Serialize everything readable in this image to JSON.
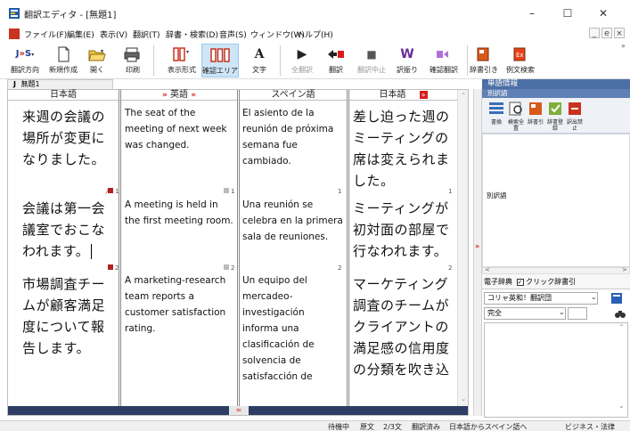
{
  "window": {
    "title": "翻訳エディタ - [無題1]",
    "min_icon": "minimize-icon",
    "max_icon": "maximize-icon",
    "close_icon": "close-icon"
  },
  "menu": {
    "items": [
      "ファイル(F)",
      "編集(E)",
      "表示(V)",
      "翻訳(T)",
      "辞書・検索(D)",
      "音声(S)",
      "ウィンドウ(W)",
      "ヘルプ(H)"
    ],
    "mdi": [
      "_",
      "ｅ",
      "×"
    ]
  },
  "toolbar": {
    "items": [
      {
        "label": "翻訳方向",
        "glyph": "J»S",
        "icon": "translation-direction-icon",
        "enabled": true
      },
      {
        "label": "新規作成",
        "glyph": "",
        "icon": "new-document-icon",
        "enabled": true
      },
      {
        "label": "開く",
        "glyph": "",
        "icon": "open-folder-icon",
        "enabled": true
      },
      {
        "label": "印刷",
        "glyph": "",
        "icon": "printer-icon",
        "enabled": true
      },
      {
        "label": "表示形式",
        "glyph": "",
        "icon": "display-format-icon",
        "enabled": true
      },
      {
        "label": "確認エリア",
        "glyph": "",
        "icon": "confirmation-area-icon",
        "enabled": true,
        "active": true
      },
      {
        "label": "文字",
        "glyph": "A",
        "icon": "font-icon",
        "enabled": true
      },
      {
        "label": "全翻訳",
        "glyph": "▶",
        "icon": "translate-all-icon",
        "enabled": false
      },
      {
        "label": "翻訳",
        "glyph": "",
        "icon": "translate-icon",
        "enabled": true
      },
      {
        "label": "翻訳中止",
        "glyph": "■",
        "icon": "stop-translation-icon",
        "enabled": false
      },
      {
        "label": "訳振り",
        "glyph": "W",
        "icon": "interlinear-icon",
        "enabled": true
      },
      {
        "label": "確認翻訳",
        "glyph": "",
        "icon": "check-translation-icon",
        "enabled": true
      }
    ],
    "right_items": [
      {
        "label": "辞書引き",
        "icon": "dictionary-lookup-icon"
      },
      {
        "label": "例文検索",
        "icon": "example-search-icon"
      }
    ],
    "overflow": "»"
  },
  "document": {
    "tab_label": "無題1",
    "tab_prefix": "J"
  },
  "columns": {
    "headers": [
      "日本語",
      "英語",
      "スペイン語",
      "日本語"
    ],
    "arrow_left": "»",
    "arrow_right": "«",
    "arrow_box": "»"
  },
  "rows": [
    {
      "num": "",
      "ja": "来週の会議の場所が変更になりました。",
      "en": "The seat of the meeting of next week was changed.",
      "es": "El asiento de la reunión de próxima semana fue cambiado.",
      "ja_back": "差し迫った週のミーティングの席は変えられました。"
    },
    {
      "num": "1",
      "ja": "会議は第一会議室でおこなわれます。",
      "en": "A meeting is held in the first meeting room.",
      "es": "Una reunión se celebra en la primera sala de reuniones.",
      "ja_back": "ミーティングが初対面の部屋で行なわれます。"
    },
    {
      "num": "2",
      "ja": "市場調査チームが顧客満足度について報告します。",
      "en": "A marketing-research team reports a customer satisfaction rating.",
      "es": "Un equipo del mercadeo-investigación informa una clasificación de solvencia de satisfacción de cliente.",
      "ja_back": "マーケティング調査のチームがクライアントの満足感の信用度の分類を吹き込"
    }
  ],
  "editor": {
    "scroll_center": "≈"
  },
  "status": {
    "items": [
      "待機中",
      "原文",
      "2/3文",
      "翻訳済み",
      "日本語からスペイン語へ",
      "ビジネス・法律"
    ]
  },
  "right_panel": {
    "header": "単語情報",
    "subheader": "別訳語",
    "icons": [
      {
        "label": "書換",
        "icon": "rewrite-icon"
      },
      {
        "label": "検索全置",
        "icon": "search-replace-icon"
      },
      {
        "label": "辞書引",
        "icon": "dictionary-icon"
      },
      {
        "label": "辞書登録",
        "icon": "dictionary-register-icon"
      },
      {
        "label": "訳出禁止",
        "icon": "prohibit-translation-icon"
      }
    ],
    "list_label": "別訳語",
    "dict_label": "電子辞典",
    "click_label": "クリック辞書引",
    "dict_select": "コリャ英和！翻訳団",
    "match_select": "完全",
    "search_icon": "binoculars-icon"
  },
  "colors": {
    "accent_red": "#d81b1b",
    "panel_blue": "#4c6fa5",
    "scroll_navy": "#2e3d66"
  }
}
